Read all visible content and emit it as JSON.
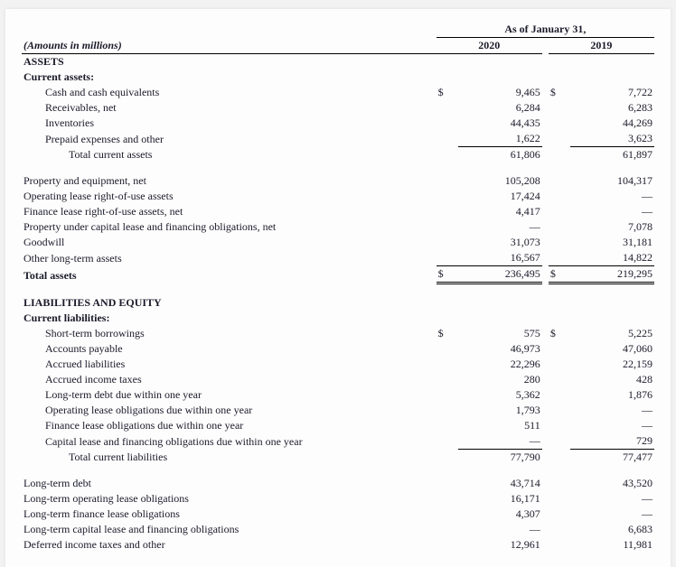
{
  "header": {
    "as_of": "As of January 31,",
    "years": [
      "2020",
      "2019"
    ],
    "units_note": "(Amounts in millions)",
    "currency": "$"
  },
  "sections": {
    "assets_title": "ASSETS",
    "current_assets_title": "Current assets:",
    "liab_title": "LIABILITIES AND EQUITY",
    "current_liab_title": "Current liabilities:"
  },
  "rows": {
    "cash": {
      "label": "Cash and cash equivalents",
      "v2020": "9,465",
      "v2019": "7,722"
    },
    "recv": {
      "label": "Receivables, net",
      "v2020": "6,284",
      "v2019": "6,283"
    },
    "inv": {
      "label": "Inventories",
      "v2020": "44,435",
      "v2019": "44,269"
    },
    "prepaid": {
      "label": "Prepaid expenses and other",
      "v2020": "1,622",
      "v2019": "3,623"
    },
    "tca": {
      "label": "Total current assets",
      "v2020": "61,806",
      "v2019": "61,897"
    },
    "pne": {
      "label": "Property and equipment, net",
      "v2020": "105,208",
      "v2019": "104,317"
    },
    "op_rou": {
      "label": "Operating lease right-of-use assets",
      "v2020": "17,424",
      "v2019": "—"
    },
    "fin_rou": {
      "label": "Finance lease right-of-use assets, net",
      "v2020": "4,417",
      "v2019": "—"
    },
    "cap_lease_prop": {
      "label": "Property under capital lease and financing obligations, net",
      "v2020": "—",
      "v2019": "7,078"
    },
    "goodwill": {
      "label": "Goodwill",
      "v2020": "31,073",
      "v2019": "31,181"
    },
    "other_lt": {
      "label": "Other long-term assets",
      "v2020": "16,567",
      "v2019": "14,822"
    },
    "total_assets": {
      "label": "Total assets",
      "v2020": "236,495",
      "v2019": "219,295"
    },
    "st_borrow": {
      "label": "Short-term borrowings",
      "v2020": "575",
      "v2019": "5,225"
    },
    "ap": {
      "label": "Accounts payable",
      "v2020": "46,973",
      "v2019": "47,060"
    },
    "accr": {
      "label": "Accrued liabilities",
      "v2020": "22,296",
      "v2019": "22,159"
    },
    "inc_tax": {
      "label": "Accrued income taxes",
      "v2020": "280",
      "v2019": "428"
    },
    "ltd_cur": {
      "label": "Long-term debt due within one year",
      "v2020": "5,362",
      "v2019": "1,876"
    },
    "op_obl_cur": {
      "label": "Operating lease obligations due within one year",
      "v2020": "1,793",
      "v2019": "—"
    },
    "fin_obl_cur": {
      "label": "Finance lease obligations due within one year",
      "v2020": "511",
      "v2019": "—"
    },
    "cap_obl_cur": {
      "label": "Capital lease and financing obligations due within one year",
      "v2020": "—",
      "v2019": "729"
    },
    "tcl": {
      "label": "Total current liabilities",
      "v2020": "77,790",
      "v2019": "77,477"
    },
    "ltd": {
      "label": "Long-term debt",
      "v2020": "43,714",
      "v2019": "43,520"
    },
    "lt_op_obl": {
      "label": "Long-term operating lease obligations",
      "v2020": "16,171",
      "v2019": "—"
    },
    "lt_fin_obl": {
      "label": "Long-term finance lease obligations",
      "v2020": "4,307",
      "v2019": "—"
    },
    "lt_cap_obl": {
      "label": "Long-term capital lease and financing obligations",
      "v2020": "—",
      "v2019": "6,683"
    },
    "def_tax": {
      "label": "Deferred income taxes and other",
      "v2020": "12,961",
      "v2019": "11,981"
    }
  }
}
